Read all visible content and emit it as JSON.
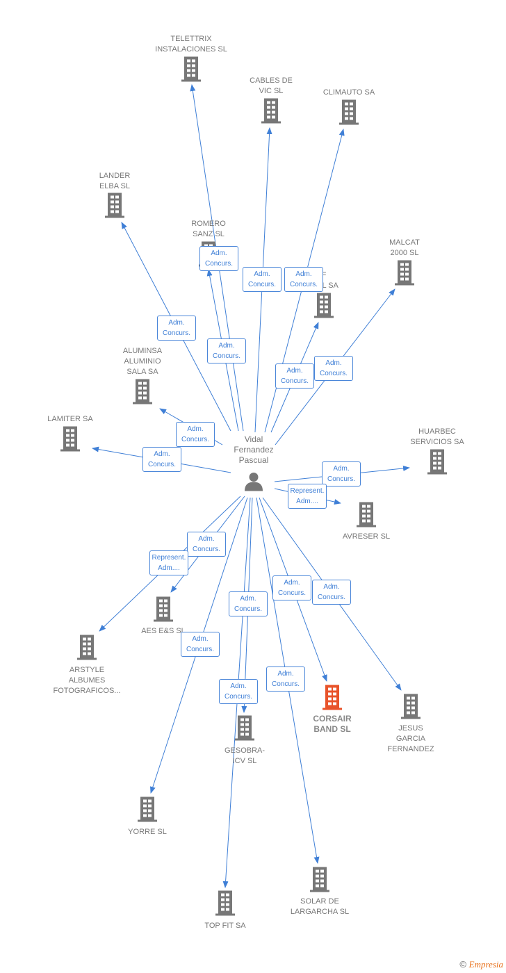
{
  "colors": {
    "edge": "#3f7fd6",
    "icon": "#777777",
    "focus_icon": "#e8532a",
    "label": "#777777"
  },
  "center": {
    "name_lines": [
      "Vidal",
      "Fernandez",
      "Pascual"
    ],
    "icon": "person-icon"
  },
  "nodes": [
    {
      "id": "telettrix",
      "lines": [
        "TELETTRIX",
        "INSTALACIONES SL"
      ],
      "edge": [
        "Adm.",
        "Concurs."
      ]
    },
    {
      "id": "cables",
      "lines": [
        "CABLES DE",
        "VIC SL"
      ],
      "edge": [
        "Adm.",
        "Concurs."
      ]
    },
    {
      "id": "climauto",
      "lines": [
        "CLIMAUTO SA"
      ],
      "edge": [
        "Adm.",
        "Concurs."
      ]
    },
    {
      "id": "lander",
      "lines": [
        "LANDER",
        "ELBA SL"
      ],
      "edge": [
        "Adm.",
        "Concurs."
      ]
    },
    {
      "id": "romero",
      "lines": [
        "ROMERO",
        "SANZ SL"
      ],
      "edge": [
        "Adm.",
        "Concurs."
      ]
    },
    {
      "id": "fcial",
      "lines": [
        "F",
        "CIAL SA"
      ],
      "edge": [
        "Adm.",
        "Concurs."
      ]
    },
    {
      "id": "malcat",
      "lines": [
        "MALCAT",
        "2000 SL"
      ],
      "edge": [
        "Adm.",
        "Concurs."
      ]
    },
    {
      "id": "aluminsa",
      "lines": [
        "ALUMINSA",
        "ALUMINIO",
        "SALA SA"
      ],
      "edge": [
        "Adm.",
        "Concurs."
      ]
    },
    {
      "id": "lamiter",
      "lines": [
        "LAMITER SA"
      ],
      "edge": [
        "Adm.",
        "Concurs."
      ]
    },
    {
      "id": "huarbec",
      "lines": [
        "HUARBEC",
        "SERVICIOS SA"
      ],
      "edge": [
        "Adm.",
        "Concurs."
      ]
    },
    {
      "id": "avreser",
      "lines": [
        "AVRESER SL"
      ],
      "edge": [
        "Represent.",
        "Adm...."
      ]
    },
    {
      "id": "aes",
      "lines": [
        "AES E&S SL"
      ],
      "edge": [
        "Adm.",
        "Concurs."
      ]
    },
    {
      "id": "arstyle",
      "lines": [
        "ARSTYLE",
        "ALBUMES",
        "FOTOGRAFICOS..."
      ],
      "edge": [
        "Represent.",
        "Adm...."
      ]
    },
    {
      "id": "corsair",
      "lines": [
        "CORSAIR",
        "BAND  SL"
      ],
      "edge": [
        "Adm.",
        "Concurs."
      ],
      "focus": true
    },
    {
      "id": "jesus",
      "lines": [
        "JESUS",
        "GARCIA",
        "FERNANDEZ"
      ],
      "edge": [
        "Adm.",
        "Concurs."
      ]
    },
    {
      "id": "gesobra",
      "lines": [
        "GESOBRA-",
        "ICV SL"
      ],
      "edge": [
        "Adm.",
        "Concurs."
      ]
    },
    {
      "id": "yorre",
      "lines": [
        "YORRE SL"
      ],
      "edge": [
        "Adm.",
        "Concurs."
      ]
    },
    {
      "id": "solar",
      "lines": [
        "SOLAR DE",
        "LARGARCHA SL"
      ],
      "edge": [
        "Adm.",
        "Concurs."
      ]
    },
    {
      "id": "topfit",
      "lines": [
        "TOP FIT SA"
      ],
      "edge": [
        "Adm.",
        "Concurs."
      ]
    }
  ],
  "footer": {
    "copyright": "©",
    "brand": "Empresia"
  }
}
